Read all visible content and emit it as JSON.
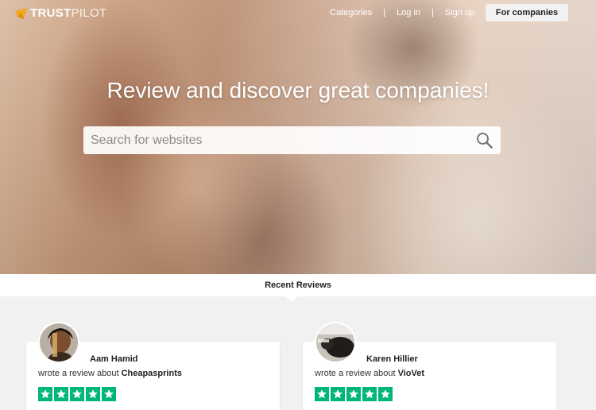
{
  "brand": {
    "trust": "TRUST",
    "pilot": "PILOT",
    "accent": "#f5a623"
  },
  "nav": {
    "categories": "Categories",
    "login": "Log in",
    "signup": "Sign up",
    "separator": "|"
  },
  "cta": {
    "for_companies": "For companies"
  },
  "hero": {
    "headline": "Review and discover great companies!"
  },
  "search": {
    "placeholder": "Search for websites",
    "value": ""
  },
  "recent": {
    "title": "Recent Reviews"
  },
  "reviews": [
    {
      "name": "Aam Hamid",
      "prefix": "wrote a review about",
      "company": "Cheapasprints",
      "rating": 5
    },
    {
      "name": "Karen Hillier",
      "prefix": "wrote a review about",
      "company": "VioVet",
      "rating": 5
    }
  ],
  "colors": {
    "star": "#00b67a"
  }
}
